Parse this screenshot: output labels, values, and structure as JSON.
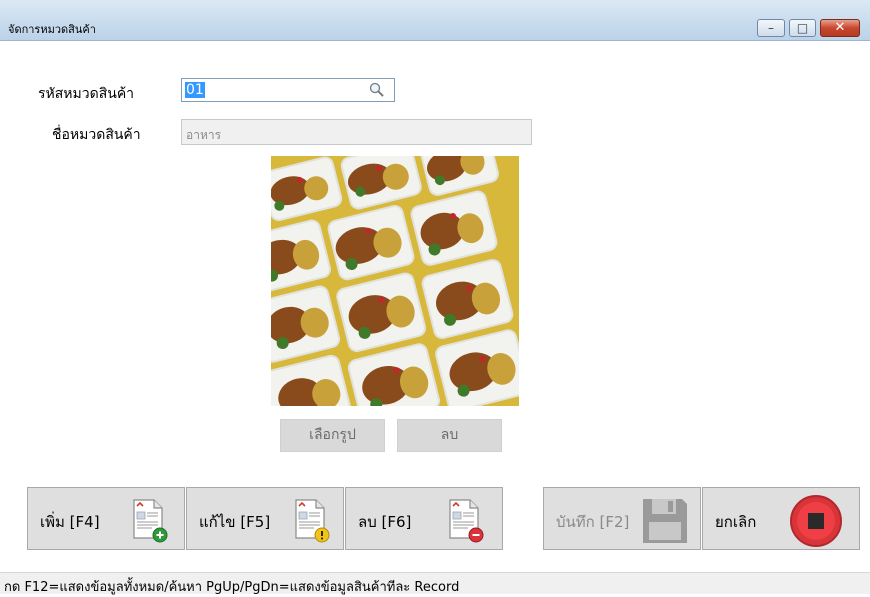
{
  "window": {
    "title": "จัดการหมวดสินค้า",
    "minimize_glyph": "–",
    "maximize_glyph": "□",
    "close_glyph": "✕"
  },
  "form": {
    "code_label": "รหัสหมวดสินค้า",
    "code_value": "01",
    "name_label": "ชื่อหมวดสินค้า",
    "name_value": "อาหาร"
  },
  "image_buttons": {
    "choose_label": "เลือกรูป",
    "delete_label": "ลบ"
  },
  "toolbar": {
    "add_label": "เพิ่ม [F4]",
    "edit_label": "แก้ไข [F5]",
    "delete_label": "ลบ [F6]",
    "save_label": "บันทึก [F2]",
    "cancel_label": "ยกเลิก"
  },
  "statusbar": {
    "text": "กด F12=แสดงข้อมูลทั้งหมด/ค้นหา  PgUp/PgDn=แสดงข้อมูลสินค้าทีละ Record"
  },
  "colors": {
    "selection": "#3399ff",
    "stop_red": "#e8383d",
    "disabled_text": "#8a8a8a"
  }
}
